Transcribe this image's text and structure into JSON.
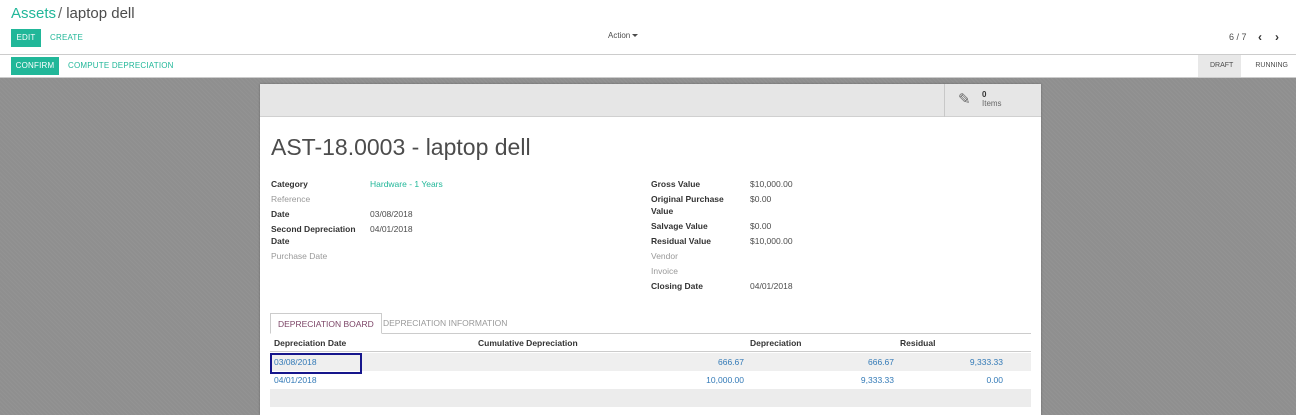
{
  "breadcrumb": {
    "parent": "Assets",
    "separator": "/",
    "current": "laptop dell"
  },
  "toolbar": {
    "edit_label": "EDIT",
    "create_label": "CREATE",
    "action_label": "Action"
  },
  "pager": {
    "value": "6 / 7",
    "prev_icon": "chevron-left-icon",
    "next_icon": "chevron-right-icon"
  },
  "statusbar": {
    "confirm_label": "CONFIRM",
    "compute_label": "COMPUTE DEPRECIATION",
    "states": [
      "DRAFT",
      "RUNNING"
    ],
    "active_state": "DRAFT"
  },
  "stat_button": {
    "icon": "pencil-icon",
    "value": "0",
    "label": "Items"
  },
  "title": "AST-18.0003 - laptop dell",
  "left_fields": [
    {
      "label": "Category",
      "value": "Hardware - 1 Years"
    },
    {
      "label": "Reference",
      "value": ""
    },
    {
      "label": "Date",
      "value": "03/08/2018"
    },
    {
      "label": "Second Depreciation Date",
      "value": "04/01/2018"
    },
    {
      "label": "Purchase Date",
      "value": ""
    }
  ],
  "right_fields": [
    {
      "label": "Gross Value",
      "value": "$10,000.00"
    },
    {
      "label": "Original Purchase Value",
      "value": "$0.00"
    },
    {
      "label": "Salvage Value",
      "value": "$0.00"
    },
    {
      "label": "Residual Value",
      "value": "$10,000.00"
    },
    {
      "label": "Vendor",
      "value": ""
    },
    {
      "label": "Invoice",
      "value": ""
    },
    {
      "label": "Closing Date",
      "value": "04/01/2018"
    }
  ],
  "tabs": [
    {
      "label": "DEPRECIATION BOARD"
    },
    {
      "label": "DEPRECIATION INFORMATION"
    }
  ],
  "table": {
    "headers": [
      "Depreciation Date",
      "Cumulative Depreciation",
      "Depreciation",
      "Residual"
    ],
    "rows": [
      {
        "date": "03/08/2018",
        "cumulative": "666.67",
        "depreciation": "666.67",
        "residual": "9,333.33"
      },
      {
        "date": "04/01/2018",
        "cumulative": "10,000.00",
        "depreciation": "9,333.33",
        "residual": "0.00"
      }
    ]
  },
  "colors": {
    "accent": "#21b799",
    "link": "#337ab7",
    "tab_active": "#7c4466",
    "focus_outline": "#16168c"
  }
}
